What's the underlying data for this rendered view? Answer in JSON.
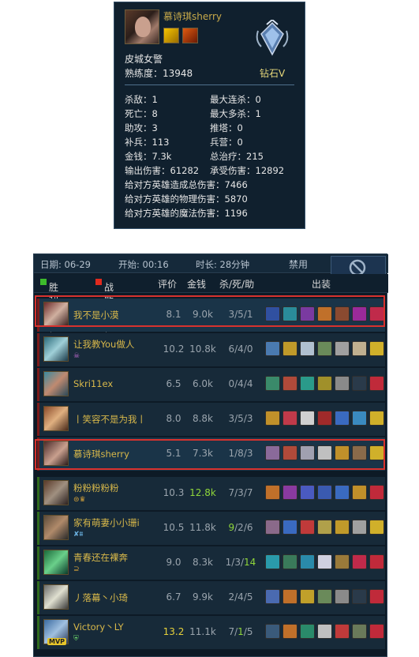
{
  "card": {
    "player_name": "慕诗琪sherry",
    "champion": "皮城女警",
    "mastery_label": "熟练度：",
    "mastery_value": "13948",
    "rank": "钻石Ⅴ",
    "stats_left": [
      {
        "label": "杀敌：",
        "value": "1"
      },
      {
        "label": "死亡：",
        "value": "8"
      },
      {
        "label": "助攻：",
        "value": "3"
      },
      {
        "label": "补兵：",
        "value": "113"
      },
      {
        "label": "金钱：",
        "value": "7.3k"
      },
      {
        "label": "输出伤害：",
        "value": "61282"
      }
    ],
    "stats_right": [
      {
        "label": "最大连杀：",
        "value": "0"
      },
      {
        "label": "最大多杀：",
        "value": "1"
      },
      {
        "label": "推塔：",
        "value": "0"
      },
      {
        "label": "兵营：",
        "value": "0"
      },
      {
        "label": "总治疗：",
        "value": "215"
      },
      {
        "label": "承受伤害：",
        "value": "12892"
      }
    ],
    "stats_full": [
      {
        "label": "给对方英雄造成总伤害：",
        "value": "7466"
      },
      {
        "label": "给对方英雄的物理伤害：",
        "value": "5870"
      },
      {
        "label": "给对方英雄的魔法伤害：",
        "value": "1196"
      }
    ]
  },
  "board": {
    "date_label": "日期:",
    "date": "06-29",
    "start_label": "开始:",
    "start": "00:16",
    "duration_label": "时长:",
    "duration": "28分钟",
    "ban_label": "禁用",
    "headers": {
      "win_team": "胜利队伍",
      "lose_team": "战败队伍",
      "score": "评价",
      "gold": "金钱",
      "kda": "杀/死/助",
      "items": "出装"
    },
    "colors": {
      "win": "#3dbb2c",
      "lose": "#e02a1e",
      "highlight_border": "#d8322e"
    },
    "rows": [
      {
        "name": "我不是小漠",
        "score": "8.1",
        "gold": "9.0k",
        "kda": "3/5/1",
        "team": "lose"
      },
      {
        "name": "让我教You做人",
        "score": "10.2",
        "gold": "10.8k",
        "kda": "6/4/0",
        "team": "lose"
      },
      {
        "name": "Skri11ex",
        "score": "6.5",
        "gold": "6.0k",
        "kda": "0/4/4",
        "team": "lose"
      },
      {
        "name": "丨笑容不是为我丨",
        "score": "8.0",
        "gold": "8.8k",
        "kda": "3/5/3",
        "team": "lose"
      },
      {
        "name": "慕诗琪sherry",
        "score": "5.1",
        "gold": "7.3k",
        "kda": "1/8/3",
        "team": "lose"
      },
      {
        "name": "粉粉粉粉粉",
        "score": "10.3",
        "gold": "12.8k",
        "kda": "7/3/7",
        "team": "win"
      },
      {
        "name": "家有萌妻小小珊i",
        "score": "10.5",
        "gold": "11.8k",
        "kda_a": "9",
        "kda_b": "/2/6",
        "team": "win"
      },
      {
        "name": "青春还在裸奔",
        "score": "9.0",
        "gold": "8.3k",
        "kda_a": "1/3/",
        "kda_b": "14",
        "team": "win"
      },
      {
        "name": "丿落幕丶小琦",
        "score": "6.7",
        "gold": "9.9k",
        "kda": "2/4/5",
        "team": "win"
      },
      {
        "name": "Victory丶LY",
        "score": "13.2",
        "gold": "11.1k",
        "kda_a": "7/",
        "kda_b": "1",
        "kda_c": "/5",
        "team": "win",
        "mvp": "MVP"
      }
    ]
  }
}
